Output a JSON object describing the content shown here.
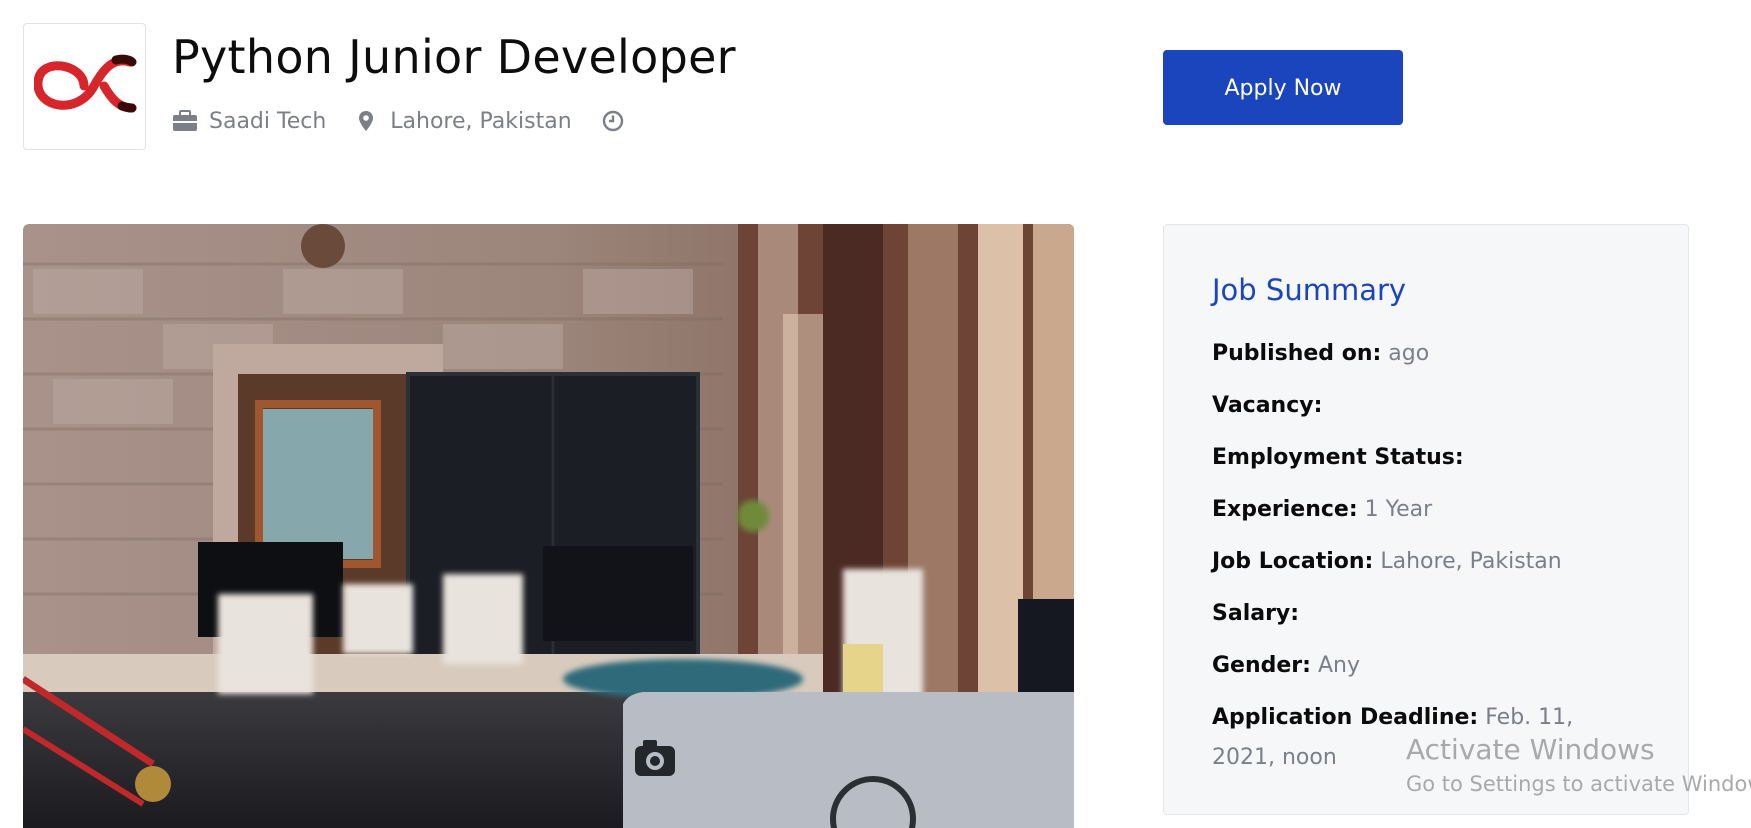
{
  "job": {
    "title": "Python Junior Developer",
    "company": "Saadi Tech",
    "location": "Lahore, Pakistan",
    "company_icon": "briefcase-icon",
    "location_icon": "map-pin-icon",
    "time_icon": "clock-icon"
  },
  "actions": {
    "apply_label": "Apply Now",
    "apply_color": "#1a45bd"
  },
  "summary": {
    "title": "Job Summary",
    "rows": [
      {
        "label": "Published on:",
        "value": "ago"
      },
      {
        "label": "Vacancy:",
        "value": ""
      },
      {
        "label": "Employment Status:",
        "value": ""
      },
      {
        "label": "Experience:",
        "value": "1 Year"
      },
      {
        "label": "Job Location:",
        "value": "Lahore, Pakistan"
      },
      {
        "label": "Salary:",
        "value": ""
      },
      {
        "label": "Gender:",
        "value": "Any"
      },
      {
        "label": "Application Deadline:",
        "value": "Feb. 11, 2021, noon"
      }
    ]
  },
  "watermark": {
    "line1": "Activate Windows",
    "line2": "Go to Settings to activate Windows."
  },
  "colors": {
    "accent": "#1a45bd",
    "muted_text": "#7b7f87",
    "logo_red": "#d7262b"
  }
}
